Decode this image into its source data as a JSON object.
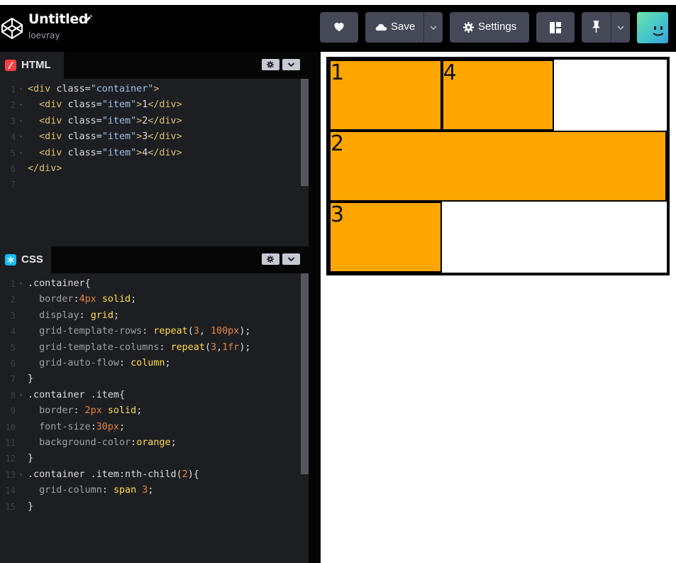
{
  "header": {
    "title": "Untitled",
    "username": "loevray",
    "buttons": {
      "save_label": "Save",
      "settings_label": "Settings"
    }
  },
  "html_panel": {
    "title": "HTML",
    "icon_color": "#ff3c41",
    "lines": [
      {
        "n": "1",
        "fold": true,
        "text": "<div class=\"container\">"
      },
      {
        "n": "2",
        "fold": true,
        "text": "  <div class=\"item\">1</div>"
      },
      {
        "n": "3",
        "fold": true,
        "text": "  <div class=\"item\">2</div>"
      },
      {
        "n": "4",
        "fold": true,
        "text": "  <div class=\"item\">3</div>"
      },
      {
        "n": "5",
        "fold": true,
        "text": "  <div class=\"item\">4</div>"
      },
      {
        "n": "6",
        "fold": false,
        "text": "</div>"
      },
      {
        "n": "7",
        "fold": false,
        "text": ""
      }
    ]
  },
  "css_panel": {
    "title": "CSS",
    "icon_color": "#0ebeff",
    "lines": [
      {
        "n": "1",
        "fold": true,
        "text": ".container{"
      },
      {
        "n": "2",
        "fold": false,
        "text": "  border:4px solid;"
      },
      {
        "n": "3",
        "fold": false,
        "text": "  display: grid;"
      },
      {
        "n": "4",
        "fold": false,
        "text": "  grid-template-rows: repeat(3, 100px);"
      },
      {
        "n": "5",
        "fold": false,
        "text": "  grid-template-columns: repeat(3,1fr);"
      },
      {
        "n": "6",
        "fold": false,
        "text": "  grid-auto-flow: column;"
      },
      {
        "n": "7",
        "fold": false,
        "text": "}"
      },
      {
        "n": "8",
        "fold": true,
        "text": ".container .item{"
      },
      {
        "n": "9",
        "fold": false,
        "text": "  border: 2px solid;"
      },
      {
        "n": "10",
        "fold": false,
        "text": "  font-size:30px;"
      },
      {
        "n": "11",
        "fold": false,
        "text": "  background-color:orange;"
      },
      {
        "n": "12",
        "fold": false,
        "text": "}"
      },
      {
        "n": "13",
        "fold": true,
        "text": ".container .item:nth-child(2){"
      },
      {
        "n": "14",
        "fold": false,
        "text": "  grid-column: span 3;"
      },
      {
        "n": "15",
        "fold": false,
        "text": "}"
      }
    ]
  },
  "preview": {
    "items": [
      {
        "label": "1",
        "row": 1,
        "col": 1,
        "span": 1
      },
      {
        "label": "4",
        "row": 1,
        "col": 2,
        "span": 1
      },
      {
        "label": "2",
        "row": 2,
        "col": 1,
        "span": 3
      },
      {
        "label": "3",
        "row": 3,
        "col": 1,
        "span": 1
      }
    ],
    "item_color": "#ffa500",
    "border_color": "#000000"
  }
}
